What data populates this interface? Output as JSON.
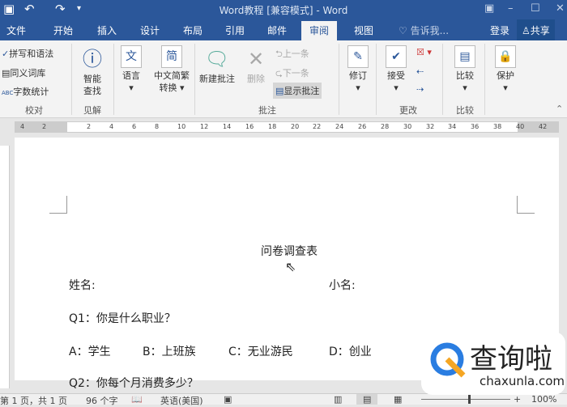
{
  "titlebar": {
    "title": "Word教程 [兼容模式] - Word"
  },
  "tabs": [
    "文件",
    "开始",
    "插入",
    "设计",
    "布局",
    "引用",
    "邮件",
    "审阅",
    "视图"
  ],
  "tell_me": "告诉我...",
  "signin": "登录",
  "share": "共享",
  "ribbon": {
    "proofing": {
      "items": [
        "拼写和语法",
        "同义词库",
        "字数统计"
      ],
      "label": "校对"
    },
    "insights": {
      "button": "智能查找",
      "label": "见解"
    },
    "language": {
      "button": "语言"
    },
    "chinese": {
      "button": "中文简繁转换"
    },
    "comments": {
      "new": "新建批注",
      "delete": "删除",
      "prev": "上一条",
      "next": "下一条",
      "show": "显示批注",
      "label": "批注"
    },
    "tracking": {
      "button": "修订"
    },
    "changes": {
      "accept": "接受",
      "label": "更改"
    },
    "compare": {
      "button": "比较",
      "label": "比较"
    },
    "protect": {
      "button": "保护"
    }
  },
  "ruler": [
    "4",
    "2",
    "2",
    "4",
    "6",
    "8",
    "10",
    "12",
    "14",
    "16",
    "18",
    "20",
    "22",
    "24",
    "26",
    "28",
    "30",
    "32",
    "34",
    "36",
    "38",
    "40",
    "42"
  ],
  "document": {
    "title": "问卷调查表",
    "name": "姓名:",
    "nickname": "小名:",
    "q1": "Q1：你是什么职业？",
    "options": [
      "A：学生",
      "B：上班族",
      "C：无业游民",
      "D：创业"
    ],
    "q2": "Q2：你每个月消费多少？"
  },
  "status": {
    "page": "第 1 页，共 1 页",
    "words": "96 个字",
    "lang": "英语(美国)",
    "zoom": "100%"
  },
  "watermark": {
    "brand": "查询啦",
    "url": "chaxunla.com"
  }
}
